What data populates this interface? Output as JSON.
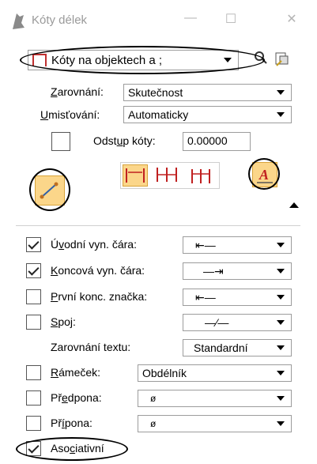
{
  "window": {
    "title": "Kóty délek",
    "minimize_glyph": "—",
    "maximize_glyph": "☐",
    "close_glyph": "✕"
  },
  "toolbar": {
    "style_value": "Kóty na objektech a ;",
    "zoom_icon": "magnifier-icon",
    "settings_icon": "dimension-settings-icon"
  },
  "zarovnani": {
    "label_u": "Z",
    "label_rest": "arovnání:",
    "value": "Skutečnost"
  },
  "umistovani": {
    "label_u": "U",
    "label_rest": "misťování:",
    "value": "Automaticky"
  },
  "odstup": {
    "label_pre": "Odst",
    "label_u": "u",
    "label_rest": "p kóty:",
    "value": "0.00000",
    "checked": false
  },
  "dimension_types": [
    "single-dimension-icon",
    "chain-dimension-icon",
    "stacked-dimension-icon"
  ],
  "options": {
    "uvodni": {
      "label_pre": "Ú",
      "label_u": "v",
      "label_rest": "odní vyn. čára:",
      "checked": true,
      "value_glyph": "⇤—",
      "icon": "arrow-start-line-icon"
    },
    "koncova": {
      "label_u": "K",
      "label_rest": "oncová vyn. čára:",
      "checked": true,
      "value_glyph": "—⇥",
      "icon": "arrow-end-line-icon"
    },
    "prvni": {
      "label_u": "P",
      "label_rest": "rvní konc. značka:",
      "checked": false,
      "value_glyph": "⇤—",
      "icon": "first-terminator-icon"
    },
    "spoj": {
      "label_u": "S",
      "label_rest": "poj:",
      "checked": false,
      "value_glyph": "—⁄—",
      "icon": "joint-icon"
    },
    "zarovnani_textu": {
      "label": "Zarovnání textu:",
      "value": "Standardní"
    },
    "ramecek": {
      "label_u": "R",
      "label_rest": "ámeček:",
      "checked": false,
      "value": "Obdélník"
    },
    "predpona": {
      "label_pre": "Př",
      "label_u": "e",
      "label_rest": "dpona:",
      "checked": false,
      "value": "ø"
    },
    "pripona": {
      "label_pre": "Př",
      "label_u": "í",
      "label_rest": "pona:",
      "checked": false,
      "value": "ø"
    },
    "asociativni": {
      "label_pre": "Aso",
      "label_u": "c",
      "label_rest": "iativní",
      "checked": true
    }
  }
}
